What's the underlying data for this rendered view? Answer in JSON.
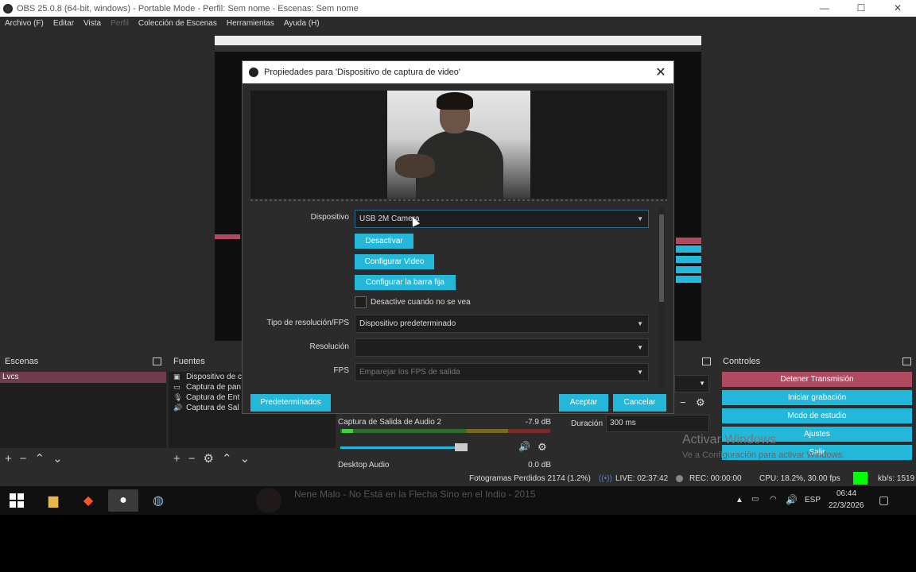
{
  "window": {
    "title": "OBS 25.0.8 (64-bit, windows) - Portable Mode - Perfil: Sem nome - Escenas: Sem nome",
    "controls": [
      "—",
      "☐",
      "✕"
    ]
  },
  "menu": [
    "Archivo (F)",
    "Editar",
    "Vista",
    "Perfil",
    "Colección de Escenas",
    "Herramientas",
    "Ayuda (H)"
  ],
  "docks": {
    "scenes": {
      "title": "Escenas",
      "items": [
        "Lvcs"
      ],
      "toolbar": [
        "+",
        "−",
        "⌃",
        "⌄"
      ]
    },
    "sources": {
      "title": "Fuentes",
      "items": [
        {
          "icon": "camera-icon",
          "glyph": "▣",
          "label": "Dispositivo de c"
        },
        {
          "icon": "screen-icon",
          "glyph": "▭",
          "label": "Captura de pan"
        },
        {
          "icon": "mic-icon",
          "glyph": "🎙",
          "label": "Captura de Ent"
        },
        {
          "icon": "speaker-icon",
          "glyph": "🔊",
          "label": "Captura de Sal"
        }
      ],
      "toolbar": [
        "+",
        "−",
        "⚙",
        "⌃",
        "⌄"
      ]
    },
    "mixer": {
      "track1": {
        "name": "Captura de Salida de Audio 2",
        "db": "-7.9 dB"
      },
      "track2": {
        "name": "Desktop Audio",
        "db": "0.0 dB"
      }
    },
    "transitions": {
      "duration_label": "Duración",
      "duration_value": "300 ms"
    },
    "controls": {
      "title": "Controles",
      "buttons": [
        "Detener Transmisión",
        "Iniciar grabación",
        "Modo de estudio",
        "Ajustes",
        "Salir"
      ]
    }
  },
  "status": {
    "dropped": "Fotogramas Perdidos 2174 (1.2%)",
    "live": "LIVE: 02:37:42",
    "rec": "REC: 00:00:00",
    "cpu": "CPU: 18.2%, 30.00 fps",
    "kbps": "kb/s: 1519"
  },
  "watermark": {
    "line1": "Activar Windows",
    "line2": "Ve a Configuración para activar Windows."
  },
  "taskbar": {
    "now_playing": "Nene Malo - No Está en la Flecha Sino en el Indio - 2015",
    "lang": "ESP",
    "time": "06:44",
    "date": "22/3/2026"
  },
  "dialog": {
    "title": "Propiedades para 'Dispositivo de captura de video'",
    "close": "✕",
    "device_label": "Dispositivo",
    "device_value": "USB 2M Camera",
    "btn_deactivate": "Desactivar",
    "btn_config_video": "Configurar Video",
    "btn_config_bar": "Configurar la barra fija",
    "checkbox_label": "Desactive cuando no se vea",
    "res_type_label": "Tipo de resolución/FPS",
    "res_type_value": "Dispositivo predeterminado",
    "resolution_label": "Resolución",
    "resolution_value": "",
    "fps_label": "FPS",
    "fps_value": "Emparejar los FPS de salida",
    "defaults": "Predeterminados",
    "ok": "Aceptar",
    "cancel": "Cancelar"
  },
  "colors": {
    "accent": "#23b8d9",
    "danger": "#b04a62",
    "bg": "#2b2b2b"
  }
}
